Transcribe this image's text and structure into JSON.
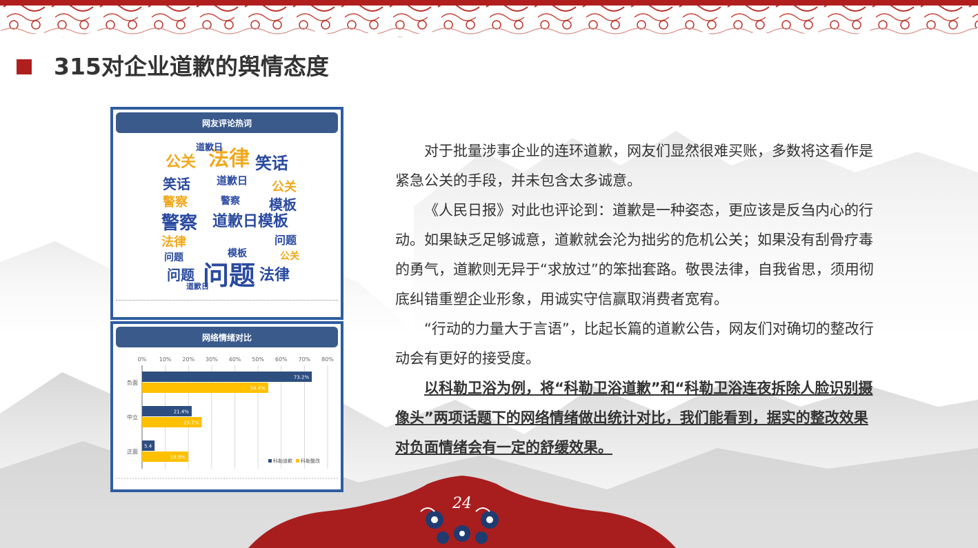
{
  "slide": {
    "title": "315对企业道歉的舆情态度",
    "page_number": "24"
  },
  "wordcloud_panel": {
    "header": "网友评论热词",
    "words": [
      {
        "text": "法律",
        "color": "#f0a81c",
        "size": 30
      },
      {
        "text": "公关",
        "color": "#f0a81c",
        "size": 22
      },
      {
        "text": "笑话",
        "color": "#2a4aa0",
        "size": 24
      },
      {
        "text": "道歉日",
        "color": "#2a4aa0",
        "size": 13
      },
      {
        "text": "笑话",
        "color": "#2a4aa0",
        "size": 20
      },
      {
        "text": "道歉日",
        "color": "#2a4aa0",
        "size": 15
      },
      {
        "text": "公关",
        "color": "#f0a81c",
        "size": 18
      },
      {
        "text": "警察",
        "color": "#f0a81c",
        "size": 18
      },
      {
        "text": "警察",
        "color": "#2a4aa0",
        "size": 14
      },
      {
        "text": "模板",
        "color": "#2a4aa0",
        "size": 20
      },
      {
        "text": "警察",
        "color": "#2a4aa0",
        "size": 26
      },
      {
        "text": "道歉日模板",
        "color": "#2a4aa0",
        "size": 22
      },
      {
        "text": "法律",
        "color": "#f0a81c",
        "size": 18
      },
      {
        "text": "问题",
        "color": "#2a4aa0",
        "size": 16
      },
      {
        "text": "模板",
        "color": "#2a4aa0",
        "size": 14
      },
      {
        "text": "问题",
        "color": "#2a4aa0",
        "size": 20
      },
      {
        "text": "问题",
        "color": "#2a4aa0",
        "size": 38
      },
      {
        "text": "法律",
        "color": "#2a4aa0",
        "size": 22
      },
      {
        "text": "问题",
        "color": "#2a4aa0",
        "size": 14
      },
      {
        "text": "道歉日",
        "color": "#2a4aa0",
        "size": 11
      },
      {
        "text": "公关",
        "color": "#f0a81c",
        "size": 14
      }
    ]
  },
  "chart_panel": {
    "header": "网络情绪对比"
  },
  "chart_data": {
    "type": "bar",
    "orientation": "horizontal",
    "title": "网络情绪对比",
    "categories": [
      "负面",
      "中立",
      "正面"
    ],
    "series": [
      {
        "name": "科勒道歉",
        "color": "#2e4e80",
        "values": [
          73.2,
          21.4,
          5.4
        ],
        "labels": [
          "73.2%",
          "21.4%",
          "5.4"
        ]
      },
      {
        "name": "科勒整改",
        "color": "#ffc000",
        "values": [
          54.4,
          25.7,
          19.9
        ],
        "labels": [
          "54.4%",
          "25.7%",
          "19.9%"
        ]
      }
    ],
    "xlim": [
      0,
      80
    ],
    "ticks": [
      "0%",
      "10%",
      "20%",
      "30%",
      "40%",
      "50%",
      "60%",
      "70%",
      "80%"
    ],
    "grid": true,
    "legend": "bottom-right"
  },
  "body_text": {
    "p1": "对于批量涉事企业的连环道歉，网友们显然很难买账，多数将这看作是紧急公关的手段，并未包含太多诚意。",
    "p2": "《人民日报》对此也评论到：道歉是一种姿态，更应该是反刍内心的行动。如果缺乏足够诚意，道歉就会沦为拙劣的危机公关；如果没有刮骨疗毒的勇气，道歉则无异于“求放过”的笨拙套路。敬畏法律，自我省思，须用彻底纠错重塑企业形象，用诚实守信赢取消费者宽宥。",
    "p3": "“行动的力量大于言语”，比起长篇的道歉公告，网友们对确切的整改行动会有更好的接受度。",
    "p4": "以科勒卫浴为例，将“科勒卫浴道歉”和“科勒卫浴连夜拆除人脸识别摄像头”两项话题下的网络情绪做出统计对比，我们能看到，据实的整改效果对负面情绪会有一定的舒缓效果。"
  },
  "colors": {
    "accent_red": "#b01e1e",
    "panel_blue": "#2e5da0",
    "header_blue": "#3a5a8c"
  }
}
